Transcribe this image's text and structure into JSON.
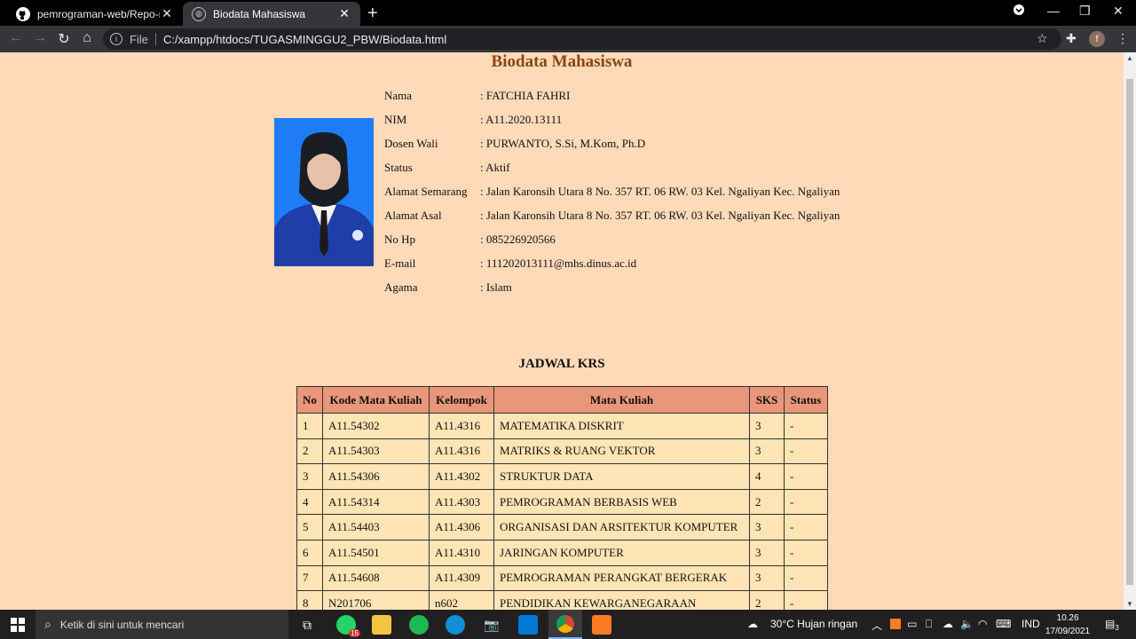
{
  "browser": {
    "tabs": [
      {
        "title": "pemrograman-web/Repo-minggu"
      },
      {
        "title": "Biodata Mahasiswa"
      }
    ],
    "address_prefix": "File",
    "url": "C:/xampp/htdocs/TUGASMINGGU2_PBW/Biodata.html",
    "profile_initial": "f"
  },
  "page": {
    "title": "Biodata Mahasiswa",
    "bio": [
      {
        "label": "Nama",
        "value": ": FATCHIA FAHRI"
      },
      {
        "label": "NIM",
        "value": ": A11.2020.13111"
      },
      {
        "label": "Dosen Wali",
        "value": ": PURWANTO, S.Si, M.Kom, Ph.D"
      },
      {
        "label": "Status",
        "value": ": Aktif"
      },
      {
        "label": "Alamat Semarang",
        "value": ": Jalan Karonsih Utara 8 No. 357 RT. 06 RW. 03 Kel. Ngaliyan Kec. Ngaliyan"
      },
      {
        "label": "Alamat Asal",
        "value": ": Jalan Karonsih Utara 8 No. 357 RT. 06 RW. 03 Kel. Ngaliyan Kec. Ngaliyan"
      },
      {
        "label": "No Hp",
        "value": ": 085226920566"
      },
      {
        "label": "E-mail",
        "value": ": 111202013111@mhs.dinus.ac.id"
      },
      {
        "label": "Agama",
        "value": ": Islam"
      }
    ],
    "krs_title": "JADWAL KRS",
    "krs_headers": [
      "No",
      "Kode Mata Kuliah",
      "Kelompok",
      "Mata Kuliah",
      "SKS",
      "Status"
    ],
    "krs_rows": [
      [
        "1",
        "A11.54302",
        "A11.4316",
        "MATEMATIKA DISKRIT",
        "3",
        "-"
      ],
      [
        "2",
        "A11.54303",
        "A11.4316",
        "MATRIKS & RUANG VEKTOR",
        "3",
        "-"
      ],
      [
        "3",
        "A11.54306",
        "A11.4302",
        "STRUKTUR DATA",
        "4",
        "-"
      ],
      [
        "4",
        "A11.54314",
        "A11.4303",
        "PEMROGRAMAN BERBASIS WEB",
        "2",
        "-"
      ],
      [
        "5",
        "A11.54403",
        "A11.4306",
        "ORGANISASI DAN ARSITEKTUR KOMPUTER",
        "3",
        "-"
      ],
      [
        "6",
        "A11.54501",
        "A11.4310",
        "JARINGAN KOMPUTER",
        "3",
        "-"
      ],
      [
        "7",
        "A11.54608",
        "A11.4309",
        "PEMROGRAMAN PERANGKAT BERGERAK",
        "3",
        "-"
      ],
      [
        "8",
        "N201706",
        "n602",
        "PENDIDIKAN KEWARGANEGARAAN",
        "2",
        "-"
      ]
    ]
  },
  "taskbar": {
    "search_placeholder": "Ketik di sini untuk mencari",
    "whatsapp_badge": "15",
    "weather": "30°C  Hujan ringan",
    "language": "IND",
    "time": "10.26",
    "date": "17/09/2021",
    "notification_count": "3"
  },
  "colors": {
    "page_bg": "#ffdab9",
    "title_color": "#8b4513",
    "table_header_bg": "#e9967a",
    "table_cell_bg": "#ffe4b5"
  }
}
